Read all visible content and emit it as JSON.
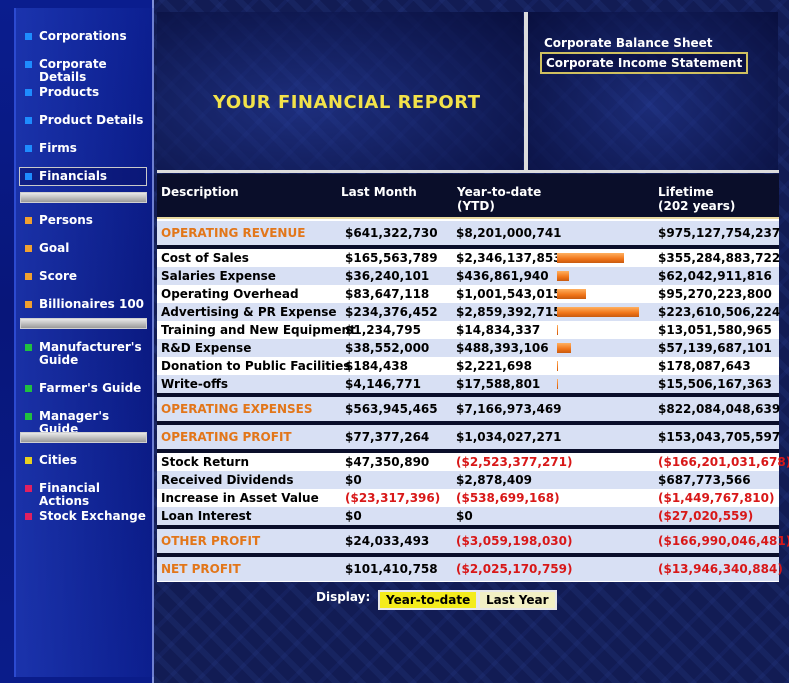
{
  "sidebar": {
    "items": [
      {
        "label": "Corporations",
        "color": "#1e8cff"
      },
      {
        "label": "Corporate Details",
        "color": "#1e8cff"
      },
      {
        "label": "Products",
        "color": "#1e8cff"
      },
      {
        "label": "Product Details",
        "color": "#1e8cff"
      },
      {
        "label": "Firms",
        "color": "#1e8cff"
      },
      {
        "label": "Financials",
        "color": "#1e8cff",
        "selected": true
      },
      {
        "label": "Persons",
        "color": "#f0a030"
      },
      {
        "label": "Goal",
        "color": "#f0a030"
      },
      {
        "label": "Score",
        "color": "#f0a030"
      },
      {
        "label": "Billionaires 100",
        "color": "#f0a030"
      },
      {
        "label": "Manufacturer's Guide",
        "color": "#20c040"
      },
      {
        "label": "Farmer's Guide",
        "color": "#20c040"
      },
      {
        "label": "Manager's Guide",
        "color": "#20c040"
      },
      {
        "label": "Cities",
        "color": "#e8d020"
      },
      {
        "label": "Financial Actions",
        "color": "#e02060"
      },
      {
        "label": "Stock Exchange",
        "color": "#e02060"
      }
    ]
  },
  "report": {
    "title": "YOUR FINANCIAL REPORT",
    "links": [
      "Corporate Balance Sheet",
      "Corporate Income Statement"
    ]
  },
  "table": {
    "headers": {
      "description": "Description",
      "last_month": "Last Month",
      "ytd_line1": "Year-to-date",
      "ytd_line2": "(YTD)",
      "lifetime_line1": "Lifetime",
      "lifetime_line2": "(202 years)"
    },
    "operating_revenue": {
      "label": "OPERATING REVENUE",
      "last": "$641,322,730",
      "ytd": "$8,201,000,741",
      "life": "$975,127,754,237"
    },
    "expenses": [
      {
        "label": "Cost of Sales",
        "last": "$165,563,789",
        "ytd": "$2,346,137,853",
        "life": "$355,284,883,722",
        "bar": 0.82
      },
      {
        "label": "Salaries Expense",
        "last": "$36,240,101",
        "ytd": "$436,861,940",
        "life": "$62,042,911,816",
        "bar": 0.15
      },
      {
        "label": "Operating Overhead",
        "last": "$83,647,118",
        "ytd": "$1,001,543,015",
        "life": "$95,270,223,800",
        "bar": 0.35
      },
      {
        "label": "Advertising & PR Expense",
        "last": "$234,376,452",
        "ytd": "$2,859,392,715",
        "life": "$223,610,506,224",
        "bar": 1.0
      },
      {
        "label": "Training and New Equipment",
        "last": "$1,234,795",
        "ytd": "$14,834,337",
        "life": "$13,051,580,965",
        "bar": 0.01
      },
      {
        "label": "R&D Expense",
        "last": "$38,552,000",
        "ytd": "$488,393,106",
        "life": "$57,139,687,101",
        "bar": 0.17
      },
      {
        "label": "Donation to Public Facilities",
        "last": "$184,438",
        "ytd": "$2,221,698",
        "life": "$178,087,643",
        "bar": 0.005
      },
      {
        "label": "Write-offs",
        "last": "$4,146,771",
        "ytd": "$17,588,801",
        "life": "$15,506,167,363",
        "bar": 0.01
      }
    ],
    "operating_expenses": {
      "label": "OPERATING EXPENSES",
      "last": "$563,945,465",
      "ytd": "$7,166,973,469",
      "life": "$822,084,048,639"
    },
    "operating_profit": {
      "label": "OPERATING PROFIT",
      "last": "$77,377,264",
      "ytd": "$1,034,027,271",
      "life": "$153,043,705,597"
    },
    "other": [
      {
        "label": "Stock Return",
        "last": "$47,350,890",
        "ytd": "($2,523,377,271)",
        "life": "($166,201,031,678)",
        "neg": [
          false,
          true,
          true
        ]
      },
      {
        "label": "Received Dividends",
        "last": "$0",
        "ytd": "$2,878,409",
        "life": "$687,773,566",
        "neg": [
          false,
          false,
          false
        ]
      },
      {
        "label": "Increase in Asset Value",
        "last": "($23,317,396)",
        "ytd": "($538,699,168)",
        "life": "($1,449,767,810)",
        "neg": [
          true,
          true,
          true
        ]
      },
      {
        "label": "Loan Interest",
        "last": "$0",
        "ytd": "$0",
        "life": "($27,020,559)",
        "neg": [
          false,
          false,
          true
        ]
      }
    ],
    "other_profit": {
      "label": "OTHER PROFIT",
      "last": "$24,033,493",
      "ytd": "($3,059,198,030)",
      "life": "($166,990,046,481)"
    },
    "net_profit": {
      "label": "NET PROFIT",
      "last": "$101,410,758",
      "ytd": "($2,025,170,759)",
      "life": "($13,946,340,884)"
    }
  },
  "display": {
    "label": "Display:",
    "options": [
      "Year-to-date",
      "Last Year"
    ],
    "selected": "Year-to-date"
  },
  "colors": {
    "accent_orange": "#e2761a",
    "negative_red": "#d81818",
    "title_yellow": "#f2e24a"
  }
}
